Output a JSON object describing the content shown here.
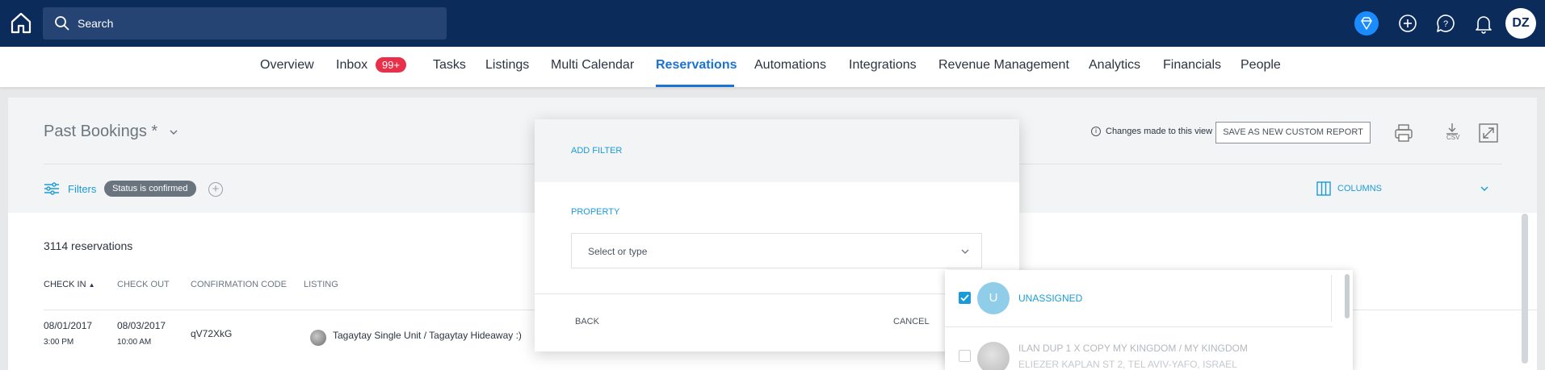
{
  "topbar": {
    "search_placeholder": "Search",
    "avatar_initials": "DZ",
    "icons": [
      "home-icon",
      "search-icon",
      "diamond-icon",
      "plus-circle-icon",
      "help-icon",
      "bell-icon"
    ]
  },
  "nav": {
    "items": [
      "Overview",
      "Inbox",
      "Tasks",
      "Listings",
      "Multi Calendar",
      "Reservations",
      "Automations",
      "Integrations",
      "Revenue Management",
      "Analytics",
      "Financials",
      "People"
    ],
    "active": "Reservations",
    "inbox_badge": "99+"
  },
  "view": {
    "title": "Past Bookings *",
    "changes_note": "Changes made to this view",
    "save_button": "SAVE AS NEW CUSTOM REPORT",
    "csv_label": "CSV"
  },
  "filters": {
    "label": "Filters",
    "chip": "Status is confirmed",
    "columns_label": "COLUMNS"
  },
  "table": {
    "count_text": "3114 reservations",
    "headers": [
      "CHECK IN",
      "CHECK OUT",
      "CONFIRMATION CODE",
      "LISTING"
    ],
    "rows": [
      {
        "check_in_date": "08/01/2017",
        "check_in_time": "3:00 PM",
        "check_out_date": "08/03/2017",
        "check_out_time": "10:00 AM",
        "code": "qV72XkG",
        "listing": "Tagaytay Single Unit / Tagaytay Hideaway :)"
      }
    ]
  },
  "modal": {
    "title": "ADD FILTER",
    "property_label": "PROPERTY",
    "select_placeholder": "Select or type",
    "back": "BACK",
    "cancel": "CANCEL"
  },
  "dropdown": {
    "items": [
      {
        "initial": "U",
        "name": "UNASSIGNED",
        "checked": true
      },
      {
        "name": "ILAN DUP 1 X COPY MY KINGDOM / MY KINGDOM",
        "address": "ELIEZER KAPLAN ST 2, TEL AVIV-YAFO, ISRAEL",
        "checked": false
      }
    ]
  },
  "colors": {
    "topbar": "#0b2b5b",
    "accent": "#1a73d4",
    "link": "#1a9bd7",
    "badge": "#e8304a"
  }
}
